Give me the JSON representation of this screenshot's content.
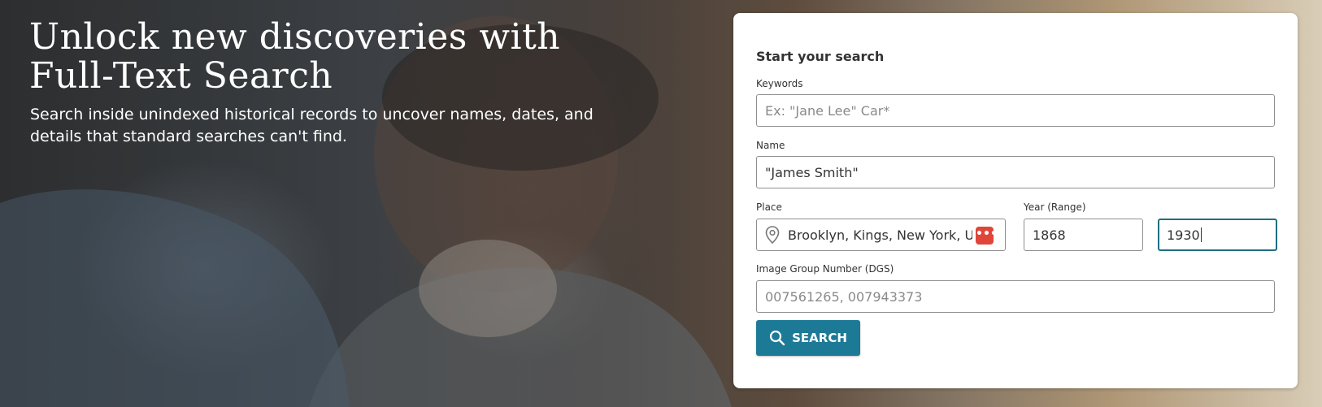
{
  "hero": {
    "headline": "Unlock new discoveries with Full-Text Search",
    "subhead": "Search inside unindexed historical records to uncover names, dates, and details that standard searches can't find."
  },
  "form": {
    "title": "Start your search",
    "keywords": {
      "label": "Keywords",
      "placeholder": "Ex: \"Jane Lee\" Car*",
      "value": ""
    },
    "name": {
      "label": "Name",
      "value": "\"James Smith\""
    },
    "place": {
      "label": "Place",
      "value": "Brooklyn, Kings, New York, United States",
      "icon": "location-pin-icon"
    },
    "year": {
      "label": "Year (Range)",
      "from": "1868",
      "to": "1930"
    },
    "dgs": {
      "label": "Image Group Number (DGS)",
      "placeholder": "007561265, 007943373",
      "value": ""
    },
    "search_button": {
      "label": "SEARCH",
      "icon": "search-icon"
    }
  },
  "extension_badge": {
    "icon": "password-manager-icon",
    "text": "•••"
  },
  "colors": {
    "button": "#1c7a96",
    "focus_border": "#1f6f80",
    "badge": "#e0453a"
  }
}
